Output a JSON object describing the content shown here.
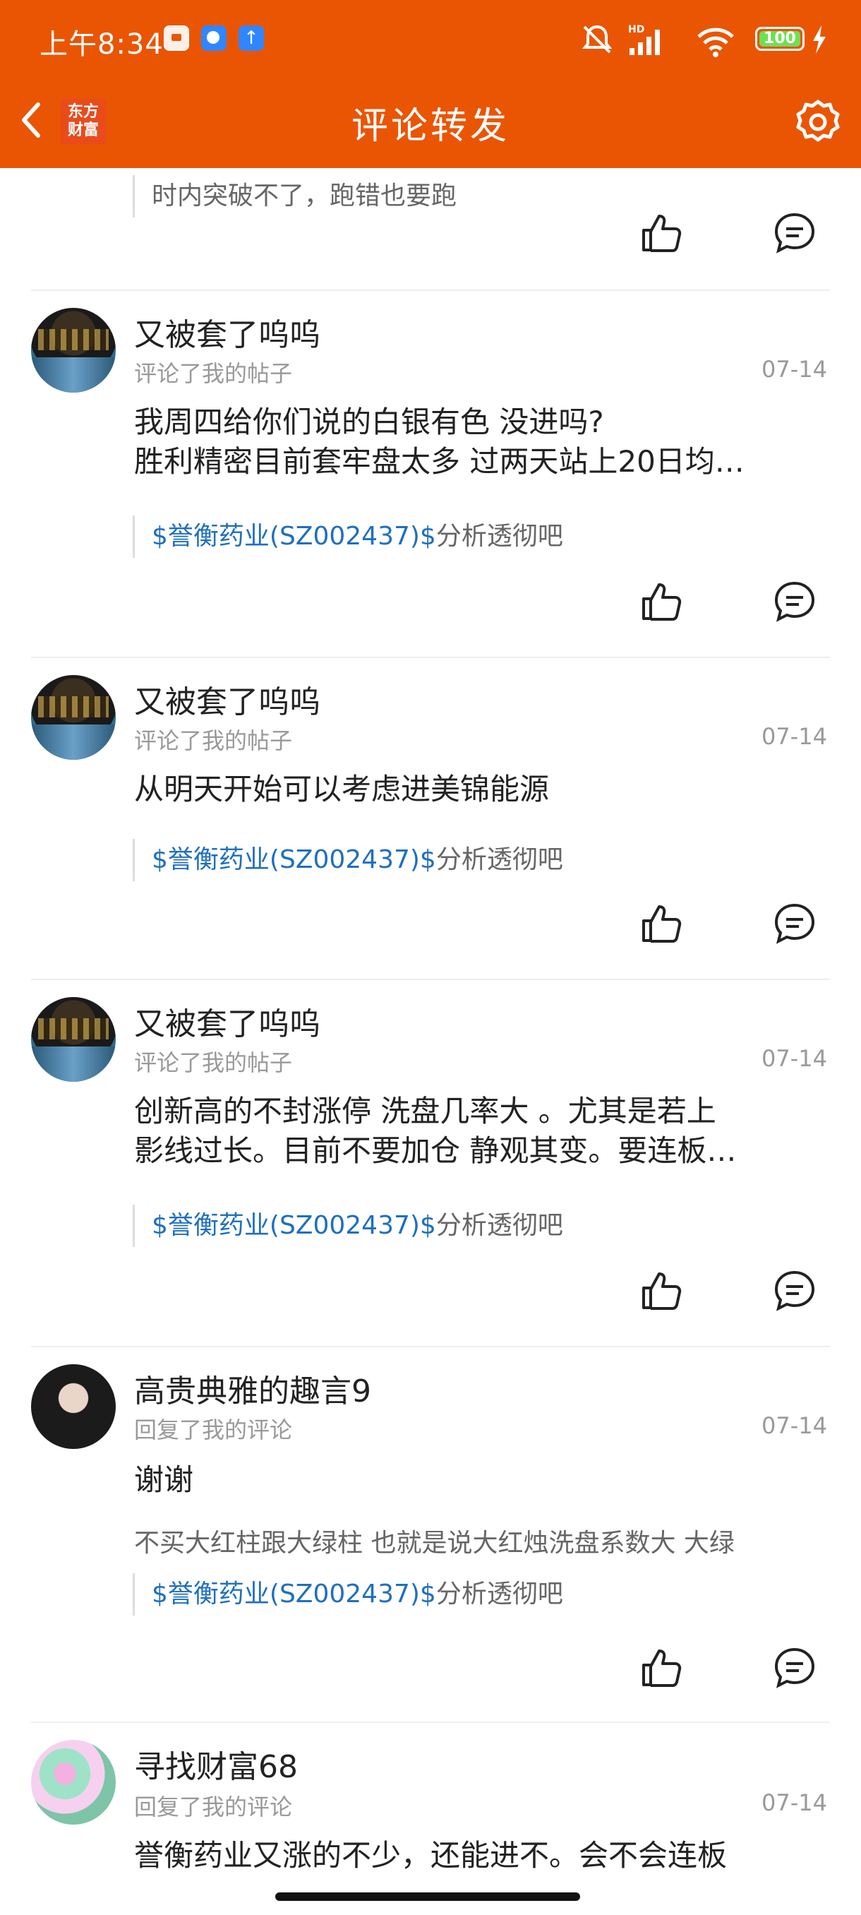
{
  "status_bar": {
    "time": "上午8:34",
    "network": "HD",
    "battery": "100"
  },
  "header": {
    "logo_text": "东方财富",
    "title": "评论转发"
  },
  "top_partial": {
    "text": "时内突破不了，跑错也要跑"
  },
  "items": [
    {
      "username": "又被套了呜呜",
      "action": "评论了我的帖子",
      "date": "07-14",
      "lines": [
        "我周四给你们说的白银有色 没进吗?",
        "胜利精密目前套牢盘太多 过两天站上20日均…"
      ],
      "stock": "$誉衡药业(SZ002437)$",
      "bar": "分析透彻吧"
    },
    {
      "username": "又被套了呜呜",
      "action": "评论了我的帖子",
      "date": "07-14",
      "lines": [
        "从明天开始可以考虑进美锦能源"
      ],
      "stock": "$誉衡药业(SZ002437)$",
      "bar": "分析透彻吧"
    },
    {
      "username": "又被套了呜呜",
      "action": "评论了我的帖子",
      "date": "07-14",
      "lines": [
        "创新高的不封涨停 洗盘几率大 。尤其是若上",
        "影线过长。目前不要加仓 静观其变。要连板…"
      ],
      "stock": "$誉衡药业(SZ002437)$",
      "bar": "分析透彻吧"
    },
    {
      "username": "高贵典雅的趣言9",
      "action": "回复了我的评论",
      "date": "07-14",
      "lines": [
        "谢谢"
      ],
      "quote": "不买大红柱跟大绿柱 也就是说大红烛洗盘系数大 大绿",
      "stock": "$誉衡药业(SZ002437)$",
      "bar": "分析透彻吧"
    },
    {
      "username": "寻找财富68",
      "action": "回复了我的评论",
      "date": "07-14",
      "lines": [
        "誉衡药业又涨的不少，还能进不。会不会连板"
      ]
    }
  ],
  "icons": {
    "like": "thumbs-up-icon",
    "comment": "comment-bubble-icon",
    "settings": "gear-icon",
    "back": "chevron-left-icon"
  },
  "colors": {
    "brand": "#ea5504",
    "link": "#1f6fbf"
  }
}
